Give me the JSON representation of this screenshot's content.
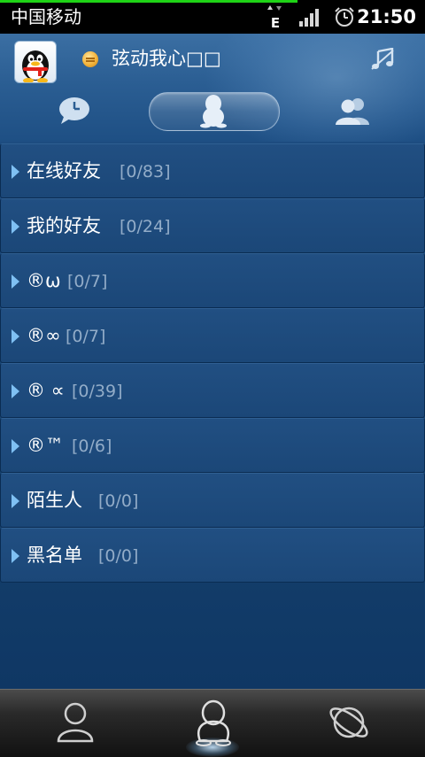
{
  "status_bar": {
    "carrier": "中国移动",
    "network_type": "E",
    "time": "21:50"
  },
  "header": {
    "nickname": "弦动我心□□",
    "icons": {
      "avatar": "qq-penguin-avatar",
      "status": "busy-status-icon",
      "music": "music-icon"
    },
    "tabs": [
      {
        "name": "recent-chats",
        "icon": "chat-clock-icon"
      },
      {
        "name": "friends",
        "icon": "penguin-icon",
        "selected": true
      },
      {
        "name": "groups",
        "icon": "people-icon"
      }
    ]
  },
  "groups": [
    {
      "name": "在线好友",
      "count": "[0/83]"
    },
    {
      "name": "我的好友",
      "count": "[0/24]"
    },
    {
      "name": "®ω",
      "count": "[0/7]"
    },
    {
      "name": "®∞",
      "count": "[0/7]"
    },
    {
      "name": "® ∝",
      "count": "[0/39]"
    },
    {
      "name": "®™",
      "count": "[0/6]"
    },
    {
      "name": "陌生人",
      "count": "[0/0]"
    },
    {
      "name": "黑名单",
      "count": "[0/0]"
    }
  ],
  "bottom_nav": [
    {
      "name": "contacts",
      "icon": "person-icon"
    },
    {
      "name": "buddies",
      "icon": "penguin-icon",
      "selected": true
    },
    {
      "name": "qzone",
      "icon": "planet-ring-icon"
    }
  ],
  "colors": {
    "background": "#0f3764",
    "header": "#2b5e93",
    "row": "#1d4b7e",
    "count_text": "#92acc8",
    "arrow": "#7fc0f3",
    "status_bar": "#000000",
    "progress": "#1fd316"
  }
}
